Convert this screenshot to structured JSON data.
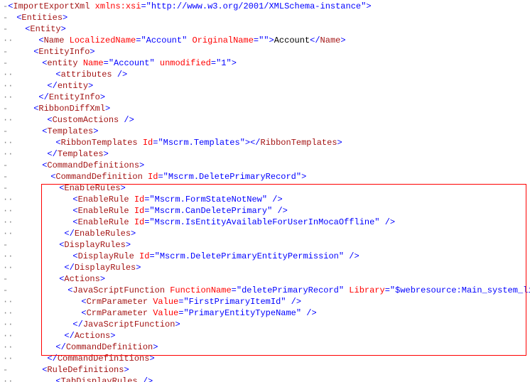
{
  "gutter": {
    "dash": "-",
    "dots": "··",
    "blank": "  "
  },
  "lines": {
    "l0": {
      "html": "<span class='b'>&lt;</span><span class='tg'>ImportExportXml</span><span class='tx'> </span><span class='at'>xmlns:xsi</span><span class='b'>=</span><span class='b'>\"http://www.w3.org/2001/XMLSchema-instance\"</span><span class='b'>&gt;</span>"
    },
    "l1": {
      "html": "<span class='b'>&lt;</span><span class='tg'>Entities</span><span class='b'>&gt;</span>"
    },
    "l2": {
      "html": "<span class='b'>&lt;</span><span class='tg'>Entity</span><span class='b'>&gt;</span>"
    },
    "l3": {
      "html": "<span class='b'>&lt;</span><span class='tg'>Name</span><span class='tx'> </span><span class='at'>LocalizedName</span><span class='b'>=\"</span><span class='b'>Account</span><span class='b'>\"</span><span class='tx'> </span><span class='at'>OriginalName</span><span class='b'>=\"\"&gt;</span><span class='tx'>Account</span><span class='b'>&lt;/</span><span class='tg'>Name</span><span class='b'>&gt;</span>"
    },
    "l4": {
      "html": "<span class='b'>&lt;</span><span class='tg'>EntityInfo</span><span class='b'>&gt;</span>"
    },
    "l5": {
      "html": "<span class='b'>&lt;</span><span class='tg'>entity</span><span class='tx'> </span><span class='at'>Name</span><span class='b'>=\"</span><span class='b'>Account</span><span class='b'>\"</span><span class='tx'> </span><span class='at'>unmodified</span><span class='b'>=\"</span><span class='b'>1</span><span class='b'>\"&gt;</span>"
    },
    "l6": {
      "html": "<span class='b'>&lt;</span><span class='tg'>attributes</span><span class='b'> /&gt;</span>"
    },
    "l7": {
      "html": "<span class='b'>&lt;/</span><span class='tg'>entity</span><span class='b'>&gt;</span>"
    },
    "l8": {
      "html": "<span class='b'>&lt;/</span><span class='tg'>EntityInfo</span><span class='b'>&gt;</span>"
    },
    "l9": {
      "html": "<span class='b'>&lt;</span><span class='tg'>RibbonDiffXml</span><span class='b'>&gt;</span>"
    },
    "l10": {
      "html": "<span class='b'>&lt;</span><span class='tg'>CustomActions</span><span class='b'> /&gt;</span>"
    },
    "l11": {
      "html": "<span class='b'>&lt;</span><span class='tg'>Templates</span><span class='b'>&gt;</span>"
    },
    "l12": {
      "html": "<span class='b'>&lt;</span><span class='tg'>RibbonTemplates</span><span class='tx'> </span><span class='at'>Id</span><span class='b'>=\"</span><span class='b'>Mscrm.Templates</span><span class='b'>\"&gt;&lt;/</span><span class='tg'>RibbonTemplates</span><span class='b'>&gt;</span>"
    },
    "l13": {
      "html": "<span class='b'>&lt;/</span><span class='tg'>Templates</span><span class='b'>&gt;</span>"
    },
    "l14": {
      "html": "<span class='b'>&lt;</span><span class='tg'>CommandDefinitions</span><span class='b'>&gt;</span>"
    },
    "l15": {
      "html": "<span class='b'>&lt;</span><span class='tg'>CommandDefinition</span><span class='tx'> </span><span class='at'>Id</span><span class='b'>=\"</span><span class='b'>Mscrm.DeletePrimaryRecord</span><span class='b'>\"&gt;</span>"
    },
    "l16": {
      "html": "<span class='b'>&lt;</span><span class='tg'>EnableRules</span><span class='b'>&gt;</span>"
    },
    "l17": {
      "html": "<span class='b'>&lt;</span><span class='tg'>EnableRule</span><span class='tx'> </span><span class='at'>Id</span><span class='b'>=\"</span><span class='b'>Mscrm.FormStateNotNew</span><span class='b'>\" /&gt;</span>"
    },
    "l18": {
      "html": "<span class='b'>&lt;</span><span class='tg'>EnableRule</span><span class='tx'> </span><span class='at'>Id</span><span class='b'>=\"</span><span class='b'>Mscrm.CanDeletePrimary</span><span class='b'>\" /&gt;</span>"
    },
    "l19": {
      "html": "<span class='b'>&lt;</span><span class='tg'>EnableRule</span><span class='tx'> </span><span class='at'>Id</span><span class='b'>=\"</span><span class='b'>Mscrm.IsEntityAvailableForUserInMocaOffline</span><span class='b'>\" /&gt;</span>"
    },
    "l20": {
      "html": "<span class='b'>&lt;/</span><span class='tg'>EnableRules</span><span class='b'>&gt;</span>"
    },
    "l21": {
      "html": "<span class='b'>&lt;</span><span class='tg'>DisplayRules</span><span class='b'>&gt;</span>"
    },
    "l22": {
      "html": "<span class='b'>&lt;</span><span class='tg'>DisplayRule</span><span class='tx'> </span><span class='at'>Id</span><span class='b'>=\"</span><span class='b'>Mscrm.DeletePrimaryEntityPermission</span><span class='b'>\" /&gt;</span>"
    },
    "l23": {
      "html": "<span class='b'>&lt;/</span><span class='tg'>DisplayRules</span><span class='b'>&gt;</span>"
    },
    "l24": {
      "html": "<span class='b'>&lt;</span><span class='tg'>Actions</span><span class='b'>&gt;</span>"
    },
    "l25": {
      "html": "<span class='b'>&lt;</span><span class='tg'>JavaScriptFunction</span><span class='tx'> </span><span class='at'>FunctionName</span><span class='b'>=\"</span><span class='b'>deletePrimaryRecord</span><span class='b'>\"</span><span class='tx'> </span><span class='at'>Library</span><span class='b'>=\"</span><span class='b'>$webresource:Main_system_library.js</span><span class='b'>\"&gt;</span>"
    },
    "l26": {
      "html": "<span class='b'>&lt;</span><span class='tg'>CrmParameter</span><span class='tx'> </span><span class='at'>Value</span><span class='b'>=\"</span><span class='b'>FirstPrimaryItemId</span><span class='b'>\" /&gt;</span>"
    },
    "l27": {
      "html": "<span class='b'>&lt;</span><span class='tg'>CrmParameter</span><span class='tx'> </span><span class='at'>Value</span><span class='b'>=\"</span><span class='b'>PrimaryEntityTypeName</span><span class='b'>\" /&gt;</span>"
    },
    "l28": {
      "html": "<span class='b'>&lt;/</span><span class='tg'>JavaScriptFunction</span><span class='b'>&gt;</span>"
    },
    "l29": {
      "html": "<span class='b'>&lt;/</span><span class='tg'>Actions</span><span class='b'>&gt;</span>"
    },
    "l30": {
      "html": "<span class='b'>&lt;/</span><span class='tg'>CommandDefinition</span><span class='b'>&gt;</span>"
    },
    "l31": {
      "html": "<span class='b'>&lt;/</span><span class='tg'>CommandDefinitions</span><span class='b'>&gt;</span>"
    },
    "l32": {
      "html": "<span class='b'>&lt;</span><span class='tg'>RuleDefinitions</span><span class='b'>&gt;</span>"
    },
    "l33": {
      "html": "<span class='b'>&lt;</span><span class='tg'>TabDisplayRules</span><span class='b'> /&gt;</span>"
    }
  },
  "layout": [
    {
      "k": "l0",
      "g": "dash",
      "ind": 0
    },
    {
      "k": "l1",
      "g": "dash",
      "ind": 1
    },
    {
      "k": "l2",
      "g": "dash",
      "ind": 2
    },
    {
      "k": "l3",
      "g": "dots",
      "ind": 3
    },
    {
      "k": "l4",
      "g": "dash",
      "ind": 3
    },
    {
      "k": "l5",
      "g": "dash",
      "ind": 4
    },
    {
      "k": "l6",
      "g": "dots",
      "ind": 5
    },
    {
      "k": "l7",
      "g": "dots",
      "ind": 4
    },
    {
      "k": "l8",
      "g": "dots",
      "ind": 3
    },
    {
      "k": "l9",
      "g": "dash",
      "ind": 3
    },
    {
      "k": "l10",
      "g": "dots",
      "ind": 4
    },
    {
      "k": "l11",
      "g": "dash",
      "ind": 4
    },
    {
      "k": "l12",
      "g": "dots",
      "ind": 5
    },
    {
      "k": "l13",
      "g": "dots",
      "ind": 4
    },
    {
      "k": "l14",
      "g": "dash",
      "ind": 4
    },
    {
      "k": "l15",
      "g": "dash",
      "ind": 5
    },
    {
      "k": "l16",
      "g": "dash",
      "ind": 6
    },
    {
      "k": "l17",
      "g": "dots",
      "ind": 7
    },
    {
      "k": "l18",
      "g": "dots",
      "ind": 7
    },
    {
      "k": "l19",
      "g": "dots",
      "ind": 7
    },
    {
      "k": "l20",
      "g": "dots",
      "ind": 6
    },
    {
      "k": "l21",
      "g": "dash",
      "ind": 6
    },
    {
      "k": "l22",
      "g": "dots",
      "ind": 7
    },
    {
      "k": "l23",
      "g": "dots",
      "ind": 6
    },
    {
      "k": "l24",
      "g": "dash",
      "ind": 6
    },
    {
      "k": "l25",
      "g": "dash",
      "ind": 7
    },
    {
      "k": "l26",
      "g": "dots",
      "ind": 8
    },
    {
      "k": "l27",
      "g": "dots",
      "ind": 8
    },
    {
      "k": "l28",
      "g": "dots",
      "ind": 7
    },
    {
      "k": "l29",
      "g": "dots",
      "ind": 6
    },
    {
      "k": "l30",
      "g": "dots",
      "ind": 5
    },
    {
      "k": "l31",
      "g": "dots",
      "ind": 4
    },
    {
      "k": "l32",
      "g": "dash",
      "ind": 4
    },
    {
      "k": "l33",
      "g": "dots",
      "ind": 5
    }
  ]
}
